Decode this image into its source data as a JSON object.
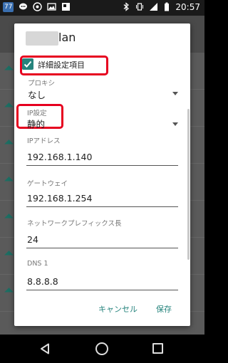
{
  "status_bar": {
    "badge": "77",
    "time": "20:57",
    "left_icons": [
      "chat-icon",
      "soccer-icon",
      "image-icon",
      "alert-icon"
    ],
    "right_icons": [
      "bluetooth-icon",
      "vibrate-icon",
      "signal-icon",
      "battery-icon"
    ]
  },
  "dialog": {
    "ssid_suffix": "lan",
    "advanced_checkbox_label": "詳細設定項目",
    "advanced_checked": true,
    "proxy": {
      "label": "プロキシ",
      "value": "なし"
    },
    "ip_settings": {
      "label": "IP設定",
      "value": "静的"
    },
    "ip_address": {
      "label": "IPアドレス",
      "value": "192.168.1.140"
    },
    "gateway": {
      "label": "ゲートウェイ",
      "value": "192.168.1.254"
    },
    "prefix_length": {
      "label": "ネットワークプレフィックス長",
      "value": "24"
    },
    "dns1": {
      "label": "DNS 1",
      "value": "8.8.8.8"
    },
    "cancel_label": "キャンセル",
    "save_label": "保存"
  },
  "colors": {
    "accent": "#26847d",
    "highlight": "#e6001f"
  }
}
